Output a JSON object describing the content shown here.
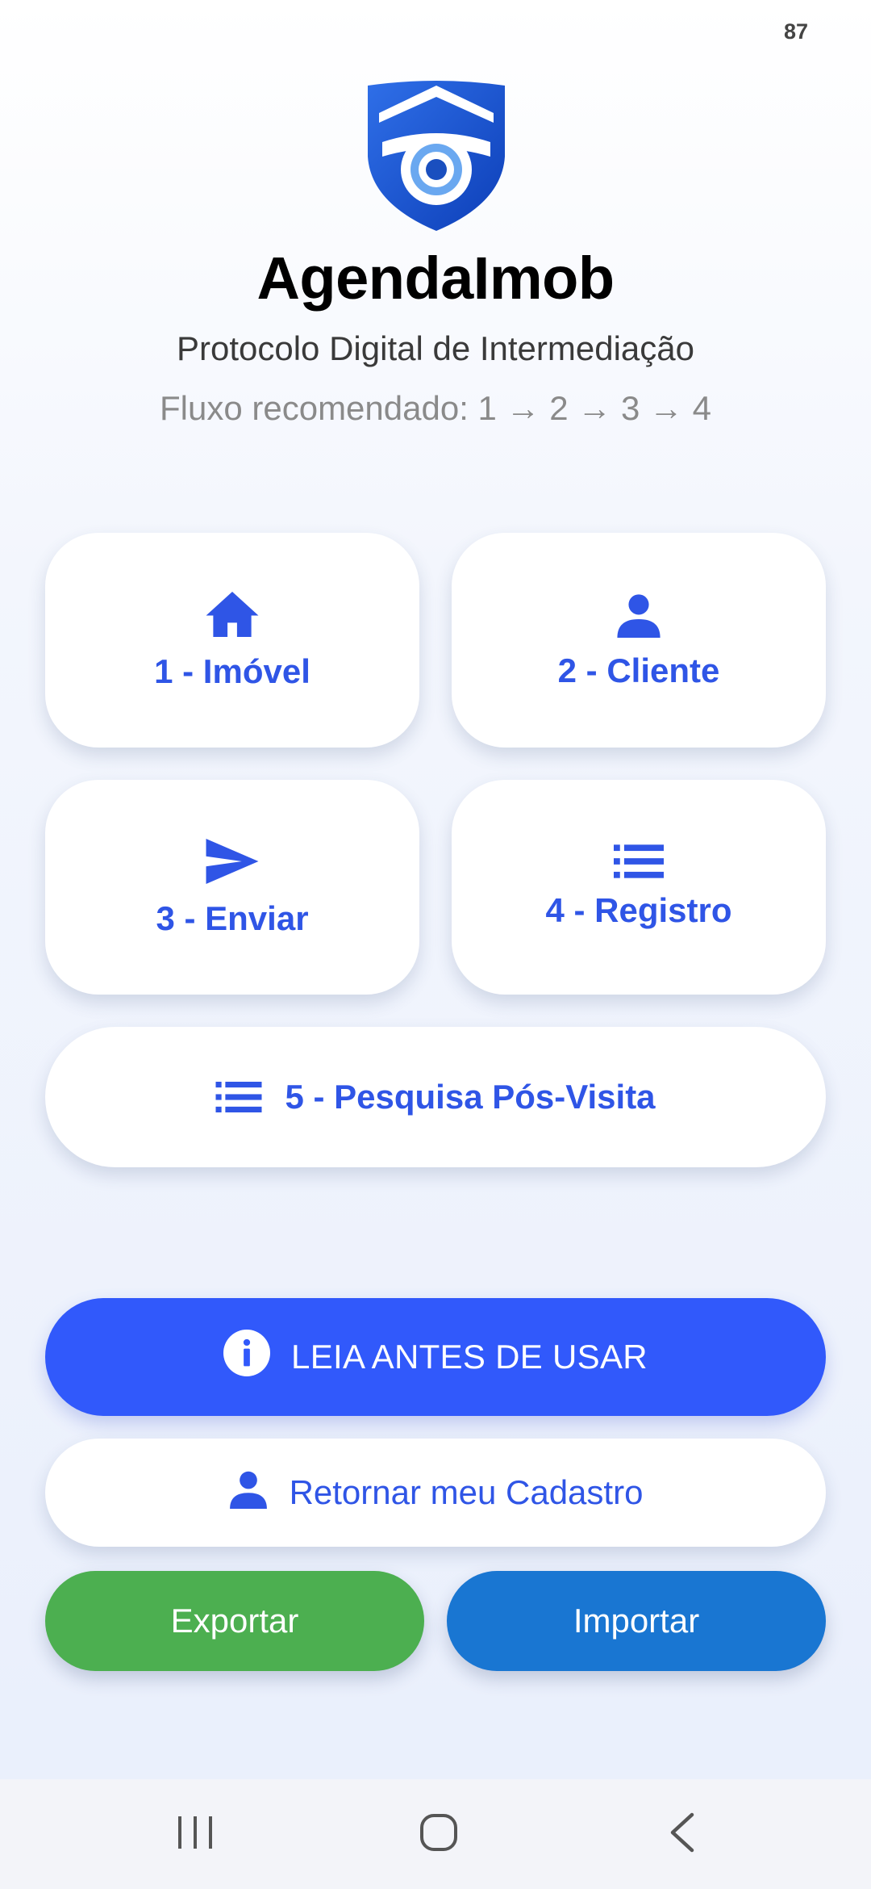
{
  "status_bar": {
    "battery": "87"
  },
  "header": {
    "app_title": "AgendaImob",
    "subtitle": "Protocolo Digital de Intermediação",
    "flow_hint": "Fluxo recomendado: 1 → 2 → 3 → 4"
  },
  "menu": {
    "imovel": {
      "label": "1 - Imóvel",
      "icon": "home-icon"
    },
    "cliente": {
      "label": "2 - Cliente",
      "icon": "person-icon"
    },
    "enviar": {
      "label": "3 - Enviar",
      "icon": "send-icon"
    },
    "registro": {
      "label": "4 - Registro",
      "icon": "list-icon"
    },
    "pesquisa": {
      "label": "5 - Pesquisa Pós-Visita",
      "icon": "list-icon"
    }
  },
  "actions": {
    "info_label": "LEIA ANTES DE USAR",
    "cadastro_label": "Retornar meu Cadastro",
    "export_label": "Exportar",
    "import_label": "Importar"
  },
  "colors": {
    "accent": "#3159FB",
    "card_text": "#2F55E6",
    "export": "#4CAF50",
    "import": "#1976D2"
  }
}
